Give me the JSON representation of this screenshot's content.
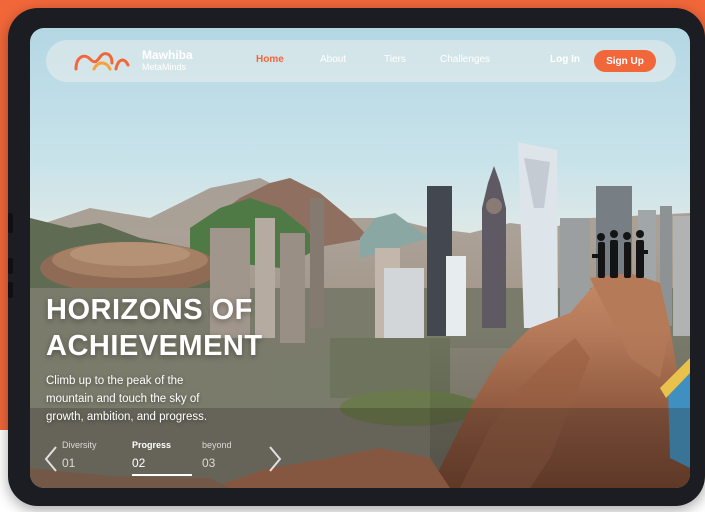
{
  "nav": {
    "brand_name": "Mawhiba",
    "brand_sub": "MetaMinds",
    "links": [
      "Home",
      "About",
      "Tiers",
      "Challenges"
    ],
    "active_link": "Home",
    "login": "Log In",
    "signup": "Sign Up"
  },
  "hero": {
    "title_line1": "HORIZONS OF",
    "title_line2": "ACHIEVEMENT",
    "subtitle_line1": "Climb up to the peak of the",
    "subtitle_line2": "mountain and touch the sky of",
    "subtitle_line3": "growth, ambition, and progress."
  },
  "slider": {
    "steps": [
      {
        "label": "Diversity",
        "number": "01"
      },
      {
        "label": "Progress",
        "number": "02"
      },
      {
        "label": "beyond",
        "number": "03"
      }
    ],
    "active_step": "02"
  },
  "colors": {
    "accent": "#f2673a",
    "frame": "#1b1d22"
  },
  "icons": [
    "logo-icon",
    "chevron-left-icon",
    "chevron-right-icon"
  ]
}
